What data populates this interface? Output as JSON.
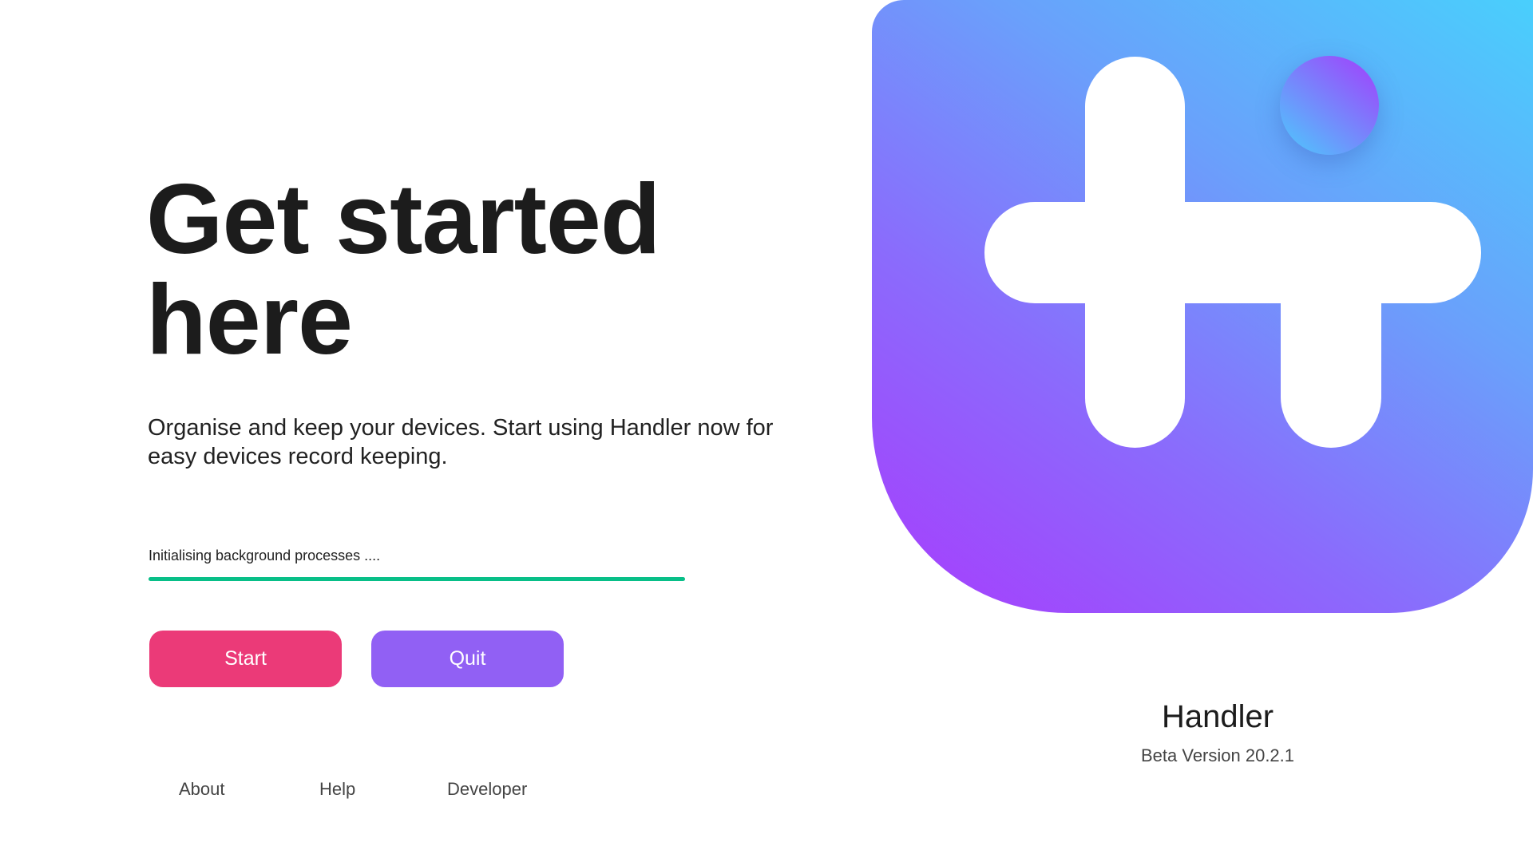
{
  "hero": {
    "headline_line1": "Get started",
    "headline_line2": "here",
    "subtitle": "Organise and keep your devices. Start using Handler now for easy devices record keeping."
  },
  "loading": {
    "status_text": "Initialising background processes ....",
    "progress_percent": 100,
    "progress_color": "#08bf88"
  },
  "actions": {
    "start_label": "Start",
    "quit_label": "Quit"
  },
  "footer_links": {
    "about": "About",
    "help": "Help",
    "developer": "Developer"
  },
  "app": {
    "name": "Handler",
    "version": "Beta Version 20.2.1",
    "logo_icon": "handler-logo-icon"
  }
}
